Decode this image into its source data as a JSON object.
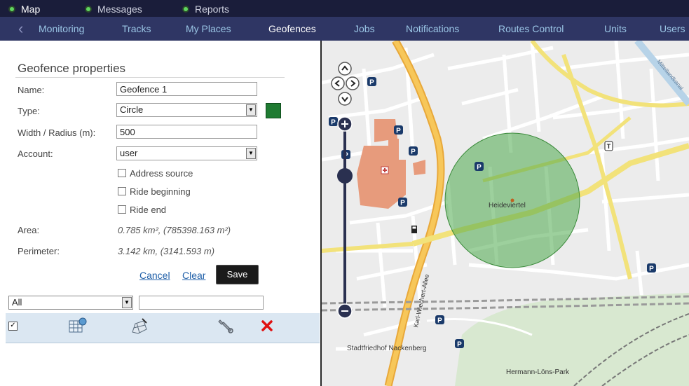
{
  "topbar": {
    "items": [
      {
        "label": "Map"
      },
      {
        "label": "Messages"
      },
      {
        "label": "Reports"
      }
    ]
  },
  "navbar": {
    "tabs": [
      {
        "label": "Monitoring"
      },
      {
        "label": "Tracks"
      },
      {
        "label": "My Places"
      },
      {
        "label": "Geofences"
      },
      {
        "label": "Jobs"
      },
      {
        "label": "Notifications"
      },
      {
        "label": "Routes Control"
      },
      {
        "label": "Units"
      },
      {
        "label": "Users"
      }
    ],
    "active_tab": "Geofences"
  },
  "panel": {
    "title": "Geofence properties",
    "name_label": "Name:",
    "name_value": "Geofence 1",
    "type_label": "Type:",
    "type_value": "Circle",
    "type_color": "#1f7b32",
    "radius_label": "Width / Radius (m):",
    "radius_value": "500",
    "account_label": "Account:",
    "account_value": "user",
    "checkboxes": [
      {
        "label": "Address source",
        "checked": false
      },
      {
        "label": "Ride beginning",
        "checked": false
      },
      {
        "label": "Ride end",
        "checked": false
      }
    ],
    "area_label": "Area:",
    "area_value": "0.785 km², (785398.163 m²)",
    "perimeter_label": "Perimeter:",
    "perimeter_value": "3.142 km, (3141.593 m)",
    "cancel_label": "Cancel",
    "clear_label": "Clear",
    "save_label": "Save"
  },
  "filter": {
    "select_value": "All",
    "search_value": ""
  },
  "list_header": {
    "select_all_checked": true,
    "icons": [
      "geofence-group-icon",
      "edit-geofence-icon",
      "properties-wrench-icon",
      "delete-icon"
    ]
  },
  "map": {
    "labels": {
      "district": "Heideviertel",
      "street": "Karl-Wiechert-Allee",
      "cemetery": "Stadtfriedhof Nackenberg",
      "park": "Hermann-Löns-Park",
      "canal": "Mittellandkanal"
    },
    "geofence_color": "#4caa4c"
  }
}
